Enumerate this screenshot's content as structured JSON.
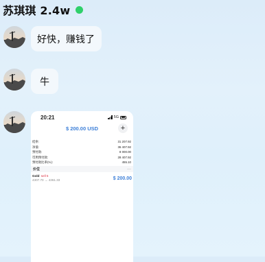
{
  "header": {
    "title": "苏琪琪 2.4w",
    "status_color": "#2fd06a"
  },
  "messages": [
    {
      "type": "text",
      "text": "好快，赚钱了"
    },
    {
      "type": "text",
      "text": "牛"
    },
    {
      "type": "image"
    }
  ],
  "screenshot": {
    "time": "20:21",
    "network": "5G",
    "balance": "$ 200.00 USD",
    "add_label": "+",
    "rows": [
      {
        "label": "结余:",
        "value": "31 207.92"
      },
      {
        "label": "净值:",
        "value": "36 407.92"
      },
      {
        "label": "预付款:",
        "value": "8 000.00"
      },
      {
        "label": "可用预付款:",
        "value": "28 407.92"
      },
      {
        "label": "预付款比率(%):",
        "value": "455.10"
      }
    ],
    "price_header": "价位",
    "more_label": "···",
    "asset": {
      "name": "Gold",
      "tag": "sell 5",
      "range": "4307.70 → 4361.33",
      "value": "$ 200.00"
    }
  }
}
